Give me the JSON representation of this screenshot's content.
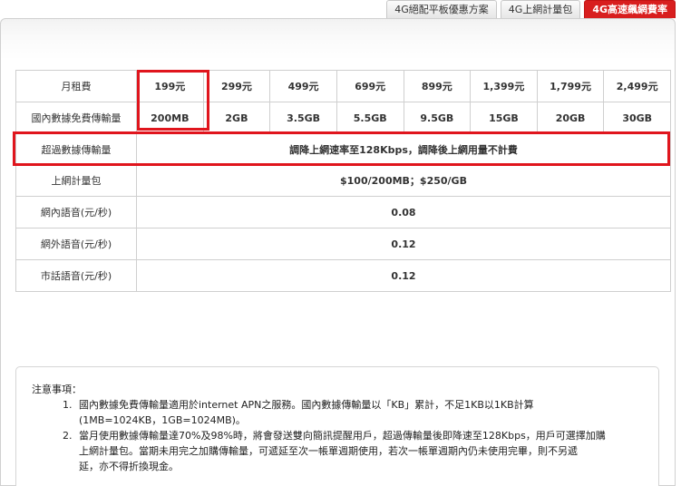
{
  "tabs": [
    {
      "label": "4G絕配平板優惠方案",
      "active": false
    },
    {
      "label": "4G上網計量包",
      "active": false
    },
    {
      "label": "4G高速飆網費率",
      "active": true
    }
  ],
  "rates_table": {
    "monthly_fee": {
      "label": "月租費",
      "values": [
        "199元",
        "299元",
        "499元",
        "699元",
        "899元",
        "1,399元",
        "1,799元",
        "2,499元"
      ]
    },
    "free_data": {
      "label": "國內數據免費傳輸量",
      "values": [
        "200MB",
        "2GB",
        "3.5GB",
        "5.5GB",
        "9.5GB",
        "15GB",
        "20GB",
        "30GB"
      ]
    },
    "overage": {
      "label": "超過數據傳輸量",
      "value": "調降上網速率至128Kbps，調降後上網用量不計費"
    },
    "data_pack": {
      "label": "上網計量包",
      "value": "$100/200MB；$250/GB"
    },
    "on_net_voice": {
      "label": "網內語音(元/秒)",
      "value": "0.08"
    },
    "off_net_voice": {
      "label": "網外語音(元/秒)",
      "value": "0.12"
    },
    "landline_voice": {
      "label": "市話語音(元/秒)",
      "value": "0.12"
    }
  },
  "notes": {
    "title": "注意事項：",
    "items": [
      {
        "num": "1.",
        "lines": [
          "國內數據免費傳輸量適用於internet APN之服務。國內數據傳輸量以「KB」累計，不足1KB以1KB計算",
          "(1MB=1024KB，1GB=1024MB)。"
        ]
      },
      {
        "num": "2.",
        "lines": [
          "當月使用數據傳輸量達70%及98%時，將會發送雙向簡訊提醒用戶，超過傳輸量後即降速至128Kbps，用戶可選擇加購",
          "上網計量包。當期未用完之加購傳輸量，可遞延至次一帳單週期使用，若次一帳單週期內仍未使用完畢，則不另遞",
          "延，亦不得折換現金。"
        ]
      }
    ]
  },
  "colors": {
    "accent": "#d81e1e",
    "highlight_border": "#e0151d",
    "grid": "#cfcfcf"
  }
}
